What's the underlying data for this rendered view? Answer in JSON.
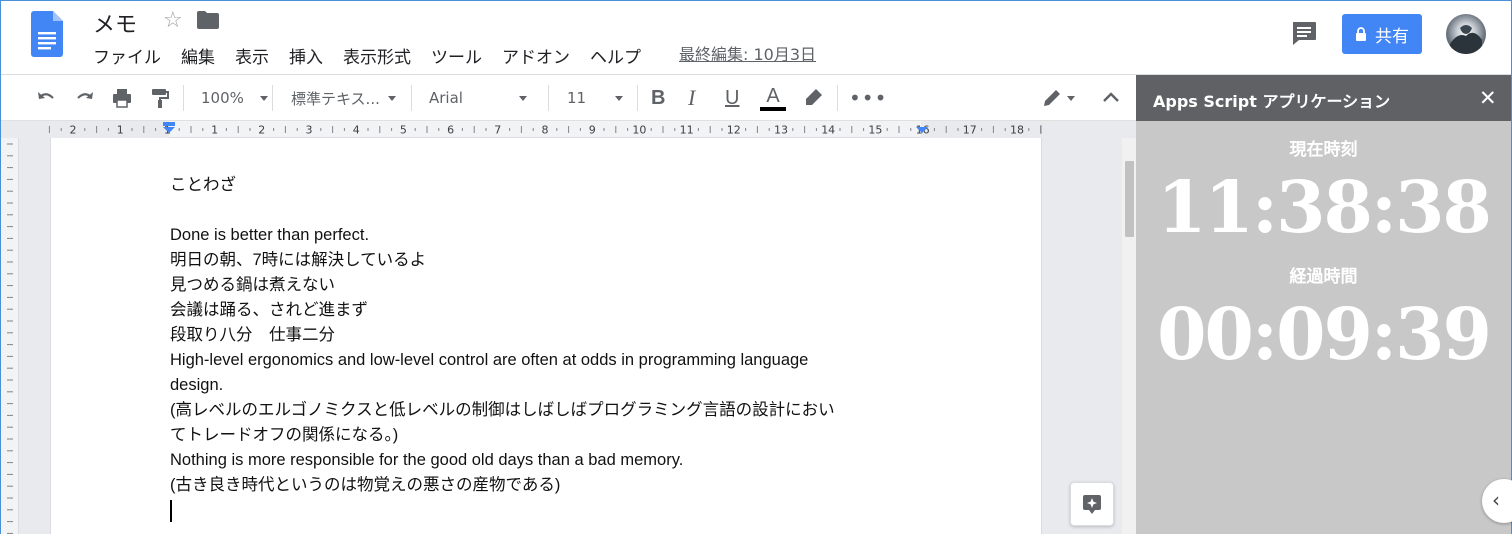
{
  "header": {
    "title": "メモ",
    "menu": [
      "ファイル",
      "編集",
      "表示",
      "挿入",
      "表示形式",
      "ツール",
      "アドオン",
      "ヘルプ"
    ],
    "last_edit": "最終編集: 10月3日",
    "share_label": "共有"
  },
  "toolbar": {
    "zoom": "100%",
    "style": "標準テキス...",
    "font": "Arial",
    "size": "11"
  },
  "ruler": {
    "labels": [
      "2",
      "1",
      "1",
      "1",
      "2",
      "3",
      "4",
      "5",
      "6",
      "7",
      "8",
      "9",
      "10",
      "11",
      "12",
      "13",
      "14",
      "15",
      "16",
      "17",
      "18"
    ]
  },
  "document": {
    "lines": [
      "ことわざ",
      "",
      "Done is better than perfect.",
      "明日の朝、7時には解決しているよ",
      "見つめる鍋は煮えない",
      "会議は踊る、されど進まず",
      "段取り八分　仕事二分",
      "High-level ergonomics and low-level control are often at odds in programming language",
      "design.",
      "(高レベルのエルゴノミクスと低レベルの制御はしばしばプログラミング言語の設計におい",
      "てトレードオフの関係になる。)",
      "Nothing is more responsible for the good old days than a bad memory.",
      "(古き良き時代というのは物覚えの悪さの産物である)"
    ]
  },
  "sidebar": {
    "title": "Apps Script アプリケーション",
    "current_label": "現在時刻",
    "current_time": "11:38:38",
    "elapsed_label": "経過時間",
    "elapsed_time": "00:09:39"
  },
  "colors": {
    "share_blue": "#4285f4",
    "sidebar_bg": "#c8c8c8",
    "sidebar_header": "#5f6164",
    "docs_blue": "#4285f4"
  }
}
